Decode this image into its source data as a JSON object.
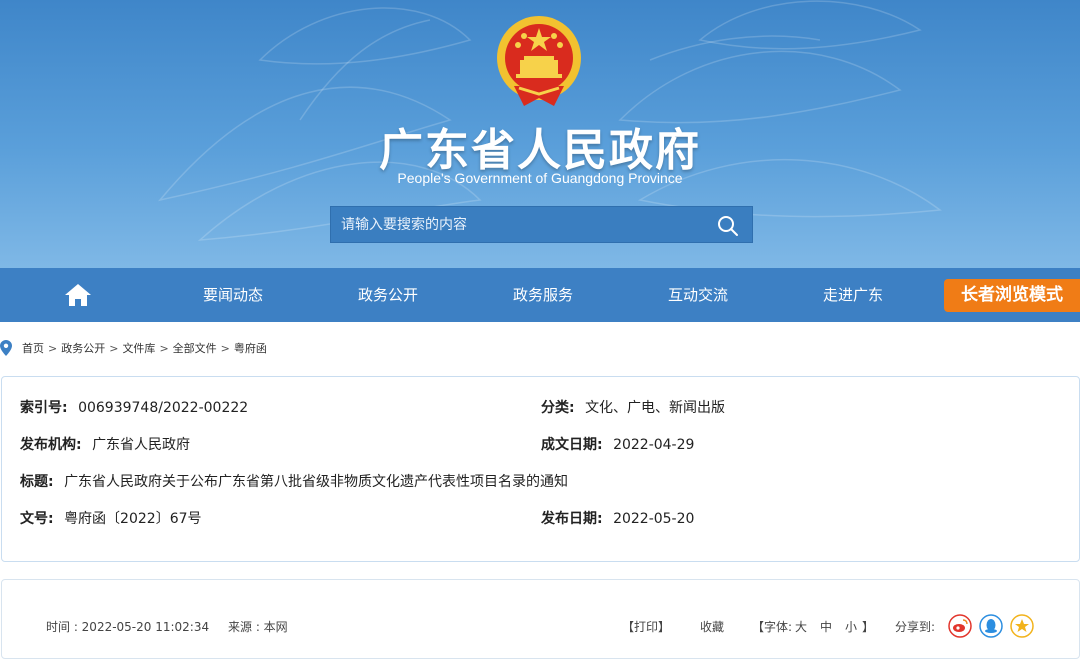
{
  "header": {
    "title": "广东省人民政府",
    "subtitle": "People's Government of Guangdong Province",
    "search_placeholder": "请输入要搜索的内容"
  },
  "nav": {
    "items": [
      "要闻动态",
      "政务公开",
      "政务服务",
      "互动交流",
      "走进广东"
    ],
    "elder_mode": "长者浏览模式"
  },
  "breadcrumb": [
    "首页",
    "政务公开",
    "文件库",
    "全部文件",
    "粤府函"
  ],
  "info": {
    "index_label": "索引号:",
    "index_value": "006939748/2022-00222",
    "category_label": "分类:",
    "category_value": "文化、广电、新闻出版",
    "issuer_label": "发布机构:",
    "issuer_value": "广东省人民政府",
    "written_date_label": "成文日期:",
    "written_date_value": "2022-04-29",
    "title_label": "标题:",
    "title_value": "广东省人民政府关于公布广东省第八批省级非物质文化遗产代表性项目名录的通知",
    "doc_no_label": "文号:",
    "doc_no_value": "粤府函〔2022〕67号",
    "publish_date_label": "发布日期:",
    "publish_date_value": "2022-05-20"
  },
  "article": {
    "time": "时间 : 2022-05-20 11:02:34",
    "source": "来源 : 本网",
    "print": "【打印】",
    "collect": "收藏",
    "font_label": "【字体:",
    "font_large": "大",
    "font_medium": "中",
    "font_small": "小",
    "font_end": "】",
    "share_label": "分享到:"
  },
  "icons": [
    "emblem-icon",
    "search-icon",
    "home-icon",
    "location-pin-icon",
    "weibo-icon",
    "qq-icon",
    "qzone-icon"
  ],
  "colors": {
    "header_blue": "#4a90d2",
    "nav_blue": "#3d80c4",
    "elder_orange": "#f07c16",
    "info_border": "#c9ddf0"
  }
}
